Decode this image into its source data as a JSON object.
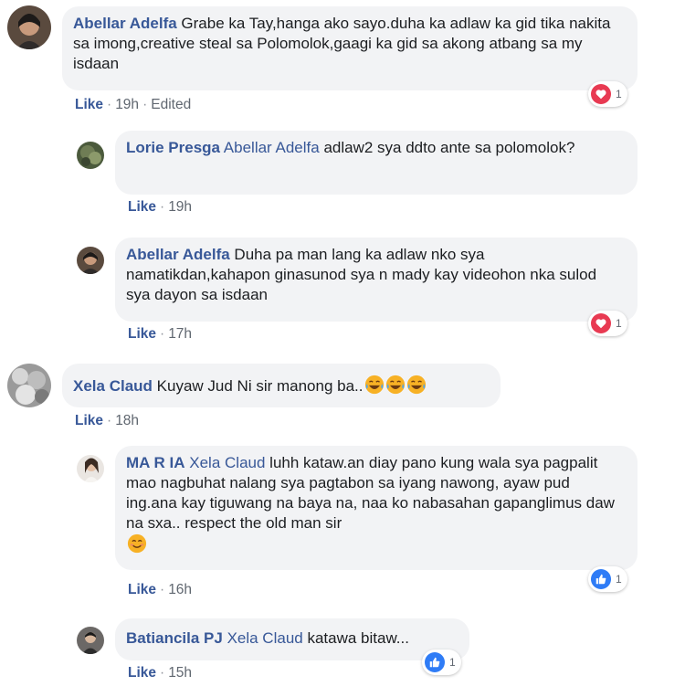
{
  "comments": [
    {
      "author": "Abellar Adelfa",
      "text": "Grabe ka Tay,hanga ako sayo.duha ka adlaw ka gid tika nakita sa imong,creative steal sa Polomolok,gaagi ka gid sa akong atbang sa my isdaan",
      "like_label": "Like",
      "time": "19h",
      "edited": "Edited",
      "reaction_type": "love",
      "reaction_count": "1"
    },
    {
      "author": "Lorie Presga",
      "mention": "Abellar Adelfa",
      "text": "adlaw2 sya ddto ante sa polomolok?",
      "like_label": "Like",
      "time": "19h"
    },
    {
      "author": "Abellar Adelfa",
      "text": "Duha pa man lang ka adlaw nko sya namatikdan,kahapon ginasunod sya n mady kay videohon nka sulod sya dayon sa isdaan",
      "like_label": "Like",
      "time": "17h",
      "reaction_type": "love",
      "reaction_count": "1"
    },
    {
      "author": "Xela Claud",
      "text": "Kuyaw Jud Ni sir manong ba..",
      "emojis": [
        "laughing-tears-emoji",
        "laughing-tears-emoji",
        "laughing-tears-emoji"
      ],
      "like_label": "Like",
      "time": "18h"
    },
    {
      "author": "MA R IA",
      "mention": "Xela Claud",
      "text": "luhh kataw.an diay pano kung wala sya pagpalit mao nagbuhat nalang sya pagtabon sa iyang nawong, ayaw pud ing.ana kay tiguwang na baya na, naa ko nabasahan gapanglimus daw na sxa.. respect the old man sir",
      "emojis": [
        "smiling-emoji"
      ],
      "like_label": "Like",
      "time": "16h",
      "reaction_type": "like",
      "reaction_count": "1"
    },
    {
      "author": "Batiancila PJ",
      "mention": "Xela Claud",
      "text": "katawa bitaw...",
      "like_label": "Like",
      "time": "15h",
      "reaction_type": "like",
      "reaction_count": "1"
    }
  ],
  "colors": {
    "name_link": "#385898",
    "bubble_bg": "#f2f3f5",
    "love_reaction": "#e83a52",
    "like_reaction": "#2f7cf6"
  }
}
